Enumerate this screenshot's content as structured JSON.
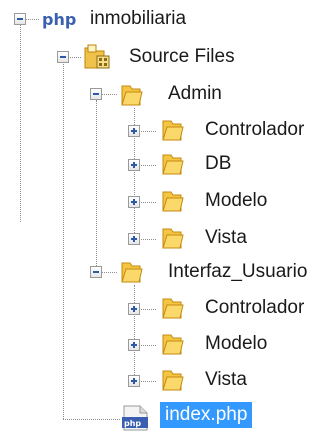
{
  "tree": {
    "project": {
      "label": "inmobiliaria",
      "icon": "php-project-icon"
    },
    "source_files": {
      "label": "Source Files",
      "icon": "source-package-icon"
    },
    "admin": {
      "label": "Admin",
      "icon": "folder-icon",
      "children": [
        {
          "label": "Controlador",
          "icon": "folder-icon",
          "expanded": false
        },
        {
          "label": "DB",
          "icon": "folder-icon",
          "expanded": false
        },
        {
          "label": "Modelo",
          "icon": "folder-icon",
          "expanded": false
        },
        {
          "label": "Vista",
          "icon": "folder-icon",
          "expanded": false
        }
      ]
    },
    "interfaz": {
      "label": "Interfaz_Usuario",
      "icon": "folder-icon",
      "children": [
        {
          "label": "Controlador",
          "icon": "folder-icon",
          "expanded": false
        },
        {
          "label": "Modelo",
          "icon": "folder-icon",
          "expanded": false
        },
        {
          "label": "Vista",
          "icon": "folder-icon",
          "expanded": false
        }
      ]
    },
    "index_file": {
      "label": "index.php",
      "icon": "php-file-icon",
      "selected": true
    }
  },
  "colors": {
    "selection": "#3399ff",
    "folder": "#f5c542",
    "php_accent": "#3a5fb0"
  }
}
